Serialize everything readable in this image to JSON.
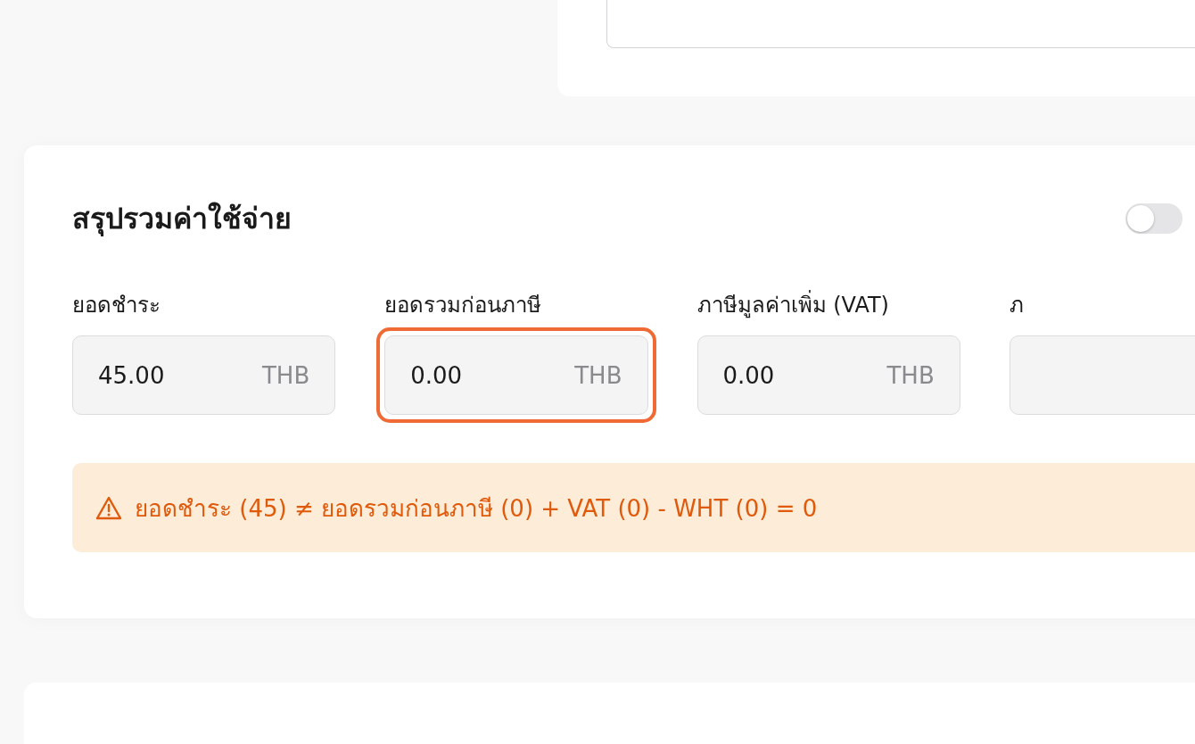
{
  "summary": {
    "title": "สรุปรวมค่าใช้จ่าย",
    "toggle": {
      "on": false
    },
    "fields": [
      {
        "label": "ยอดชำระ",
        "value": "45.00",
        "unit": "THB",
        "highlighted": false
      },
      {
        "label": "ยอดรวมก่อนภาษี",
        "value": "0.00",
        "unit": "THB",
        "highlighted": true
      },
      {
        "label": "ภาษีมูลค่าเพิ่ม (VAT)",
        "value": "0.00",
        "unit": "THB",
        "highlighted": false
      },
      {
        "label": "ภ",
        "highlighted": false
      }
    ],
    "warning": "ยอดชำระ (45) ≠ ยอดรวมก่อนภาษี (0) + VAT (0) - WHT (0) = 0"
  }
}
